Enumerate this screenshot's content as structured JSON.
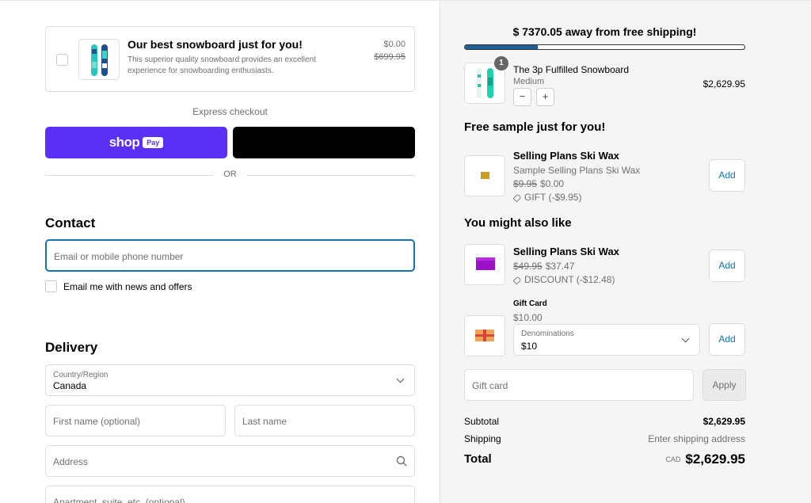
{
  "upsell": {
    "title": "Our best snowboard just for you!",
    "description": "This superior quality snowboard provides an excellent experience for snowboarding enthusiasts.",
    "price": "$0.00",
    "compare_price": "$699.95"
  },
  "express": {
    "label": "Express checkout",
    "shop_logo": "shop",
    "shop_pay": "Pay",
    "divider": "OR"
  },
  "contact": {
    "heading": "Contact",
    "email_placeholder": "Email or mobile phone number",
    "newsletter_label": "Email me with news and offers"
  },
  "delivery": {
    "heading": "Delivery",
    "country_label": "Country/Region",
    "country_value": "Canada",
    "first_name_placeholder": "First name (optional)",
    "last_name_placeholder": "Last name",
    "address_placeholder": "Address",
    "apartment_placeholder": "Apartment, suite, etc. (optional)"
  },
  "shipping_banner": {
    "message": "$ 7370.05 away from free shipping!",
    "progress_fraction": 0.26
  },
  "cart": {
    "item": {
      "name": "The 3p Fulfilled Snowboard",
      "variant": "Medium",
      "price": "$2,629.95",
      "quantity": "1",
      "minus": "−",
      "plus": "+"
    }
  },
  "free_sample": {
    "heading": "Free sample just for you!",
    "name": "Selling Plans Ski Wax",
    "subtitle": "Sample Selling Plans Ski Wax",
    "compare_price": "$9.95",
    "price": "$0.00",
    "tag": "GIFT (-$9.95)",
    "add_label": "Add"
  },
  "also_like": {
    "heading": "You might also like",
    "wax": {
      "name": "Selling Plans Ski Wax",
      "compare_price": "$49.95",
      "price": "$37.47",
      "tag": "DISCOUNT (-$12.48)",
      "add_label": "Add"
    },
    "gift_card": {
      "name": "Gift Card",
      "price": "$10.00",
      "denom_label": "Denominations",
      "denom_value": "$10",
      "add_label": "Add"
    }
  },
  "gift_input": {
    "placeholder": "Gift card",
    "apply_label": "Apply"
  },
  "summary": {
    "subtotal_label": "Subtotal",
    "subtotal_value": "$2,629.95",
    "shipping_label": "Shipping",
    "shipping_value": "Enter shipping address",
    "total_label": "Total",
    "currency": "CAD",
    "total_value": "$2,629.95"
  },
  "colors": {
    "shop_pay": "#5a31f4",
    "accent_blue": "#1773b0",
    "progress_fill": "#1f5f99"
  }
}
